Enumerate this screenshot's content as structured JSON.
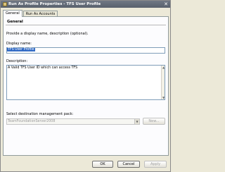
{
  "window": {
    "title": "Run As Profile Properties - TFS User Profile",
    "close_glyph": "✕"
  },
  "tabs": [
    {
      "label": "General"
    },
    {
      "label": "Run As Accounts"
    }
  ],
  "general": {
    "header": "General",
    "instructions": "Provide a display name, description (optional).",
    "display_name_label": "Display name:",
    "display_name_value": "TFS User Profile",
    "description_label": "Description:",
    "description_value": "A Valid TFS User ID which can access TFS",
    "mp_label": "Select destination management pack:",
    "mp_value": "TeamFoundationServer2008",
    "new_button": "New..."
  },
  "footer": {
    "ok": "OK",
    "cancel": "Cancel",
    "apply": "Apply"
  },
  "colors": {
    "selection": "#316ac5",
    "titlebar": "#6f7784"
  }
}
